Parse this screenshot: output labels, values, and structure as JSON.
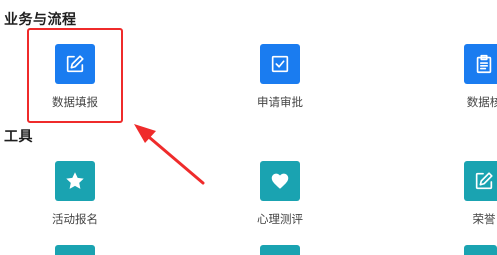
{
  "sections": {
    "business": {
      "title": "业务与流程"
    },
    "tools": {
      "title": "工具"
    }
  },
  "business_apps": [
    {
      "label": "数据填报",
      "icon": "edit-icon",
      "color": "#1a7cf0"
    },
    {
      "label": "申请审批",
      "icon": "checkbox-icon",
      "color": "#1a7cf0"
    },
    {
      "label": "数据核",
      "icon": "clipboard-icon",
      "color": "#1a7cf0"
    }
  ],
  "tool_apps": [
    {
      "label": "活动报名",
      "icon": "star-icon",
      "color": "#1aa3b1"
    },
    {
      "label": "心理测评",
      "icon": "heart-icon",
      "color": "#1aa3b1"
    },
    {
      "label": "荣誉",
      "icon": "edit-icon",
      "color": "#1aa3b1"
    }
  ],
  "annotation": {
    "highlight_color": "#ef2b2b"
  }
}
